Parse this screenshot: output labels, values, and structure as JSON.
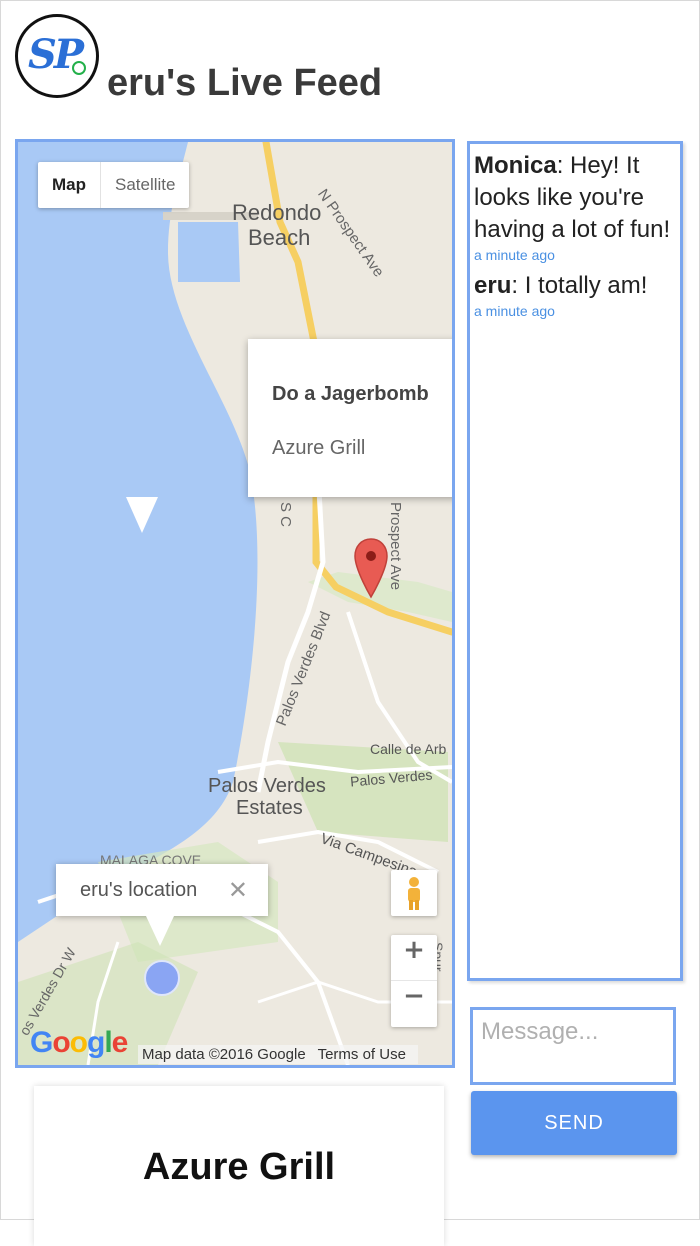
{
  "header": {
    "logo_text": "SP",
    "title": "eru's Live Feed"
  },
  "map": {
    "type_control": {
      "map_label": "Map",
      "satellite_label": "Satellite"
    },
    "labels": {
      "redondo": "Redondo",
      "beach": "Beach",
      "n_prospect": "N Prospect Ave",
      "prospect": "Prospect Ave",
      "palos_blvd": "Palos Verdes Blvd",
      "calle": "Calle de Arb",
      "pv_estates_1": "Palos Verdes",
      "pv_estates_2": "Estates",
      "palos_verdes_road": "Palos Verdes",
      "via_campesina": "Via Campesina",
      "malaga_cove": "MALAGA COVE",
      "verdes_dr": "os Verdes Dr W",
      "s_c": "S C",
      "spur": "Spur"
    },
    "info_window": {
      "title": "Do a Jagerbomb",
      "subtitle": "Azure Grill"
    },
    "location_bubble": {
      "text": "eru's location",
      "close": "✕"
    },
    "zoom_in": "+",
    "zoom_out": "−",
    "google": "Google",
    "map_data": "Map data ©2016 Google",
    "terms": "Terms of Use"
  },
  "feed": {
    "messages": [
      {
        "user": "Monica",
        "text": ": Hey! It looks like you're having a lot of fun!",
        "time": "a minute ago"
      },
      {
        "user": "eru",
        "text": ": I totally am!",
        "time": "a minute ago"
      }
    ]
  },
  "compose": {
    "placeholder": "Message...",
    "send_label": "SEND"
  },
  "card": {
    "title": "Azure Grill"
  },
  "colors": {
    "accent": "#5b95ee",
    "border": "#7aa6ef",
    "link": "#4a90e2",
    "water": "#a7c8f4",
    "marker": "#e85b53"
  }
}
